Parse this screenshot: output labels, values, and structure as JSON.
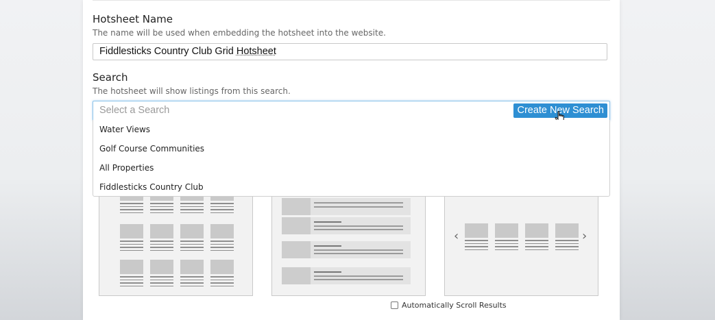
{
  "hotsheet_name": {
    "label": "Hotsheet Name",
    "help": "The name will be used when embedding the hotsheet into the website.",
    "value_part1": "Fiddlesticks Country Club Grid ",
    "value_part2": "Hotsheet"
  },
  "search": {
    "label": "Search",
    "help": "The hotsheet will show listings from this search.",
    "placeholder": "Select a Search",
    "create_button": "Create New Search",
    "options": [
      "Water Views",
      "Golf Course Communities",
      "All Properties",
      "Fiddlesticks Country Club"
    ]
  },
  "layouts": {
    "auto_scroll_label": "Automatically Scroll Results",
    "auto_scroll_checked": false,
    "prev_arrow": "‹",
    "next_arrow": "›"
  },
  "colors": {
    "accent": "#2e8fd3",
    "focus_border": "#8cc4ea"
  }
}
